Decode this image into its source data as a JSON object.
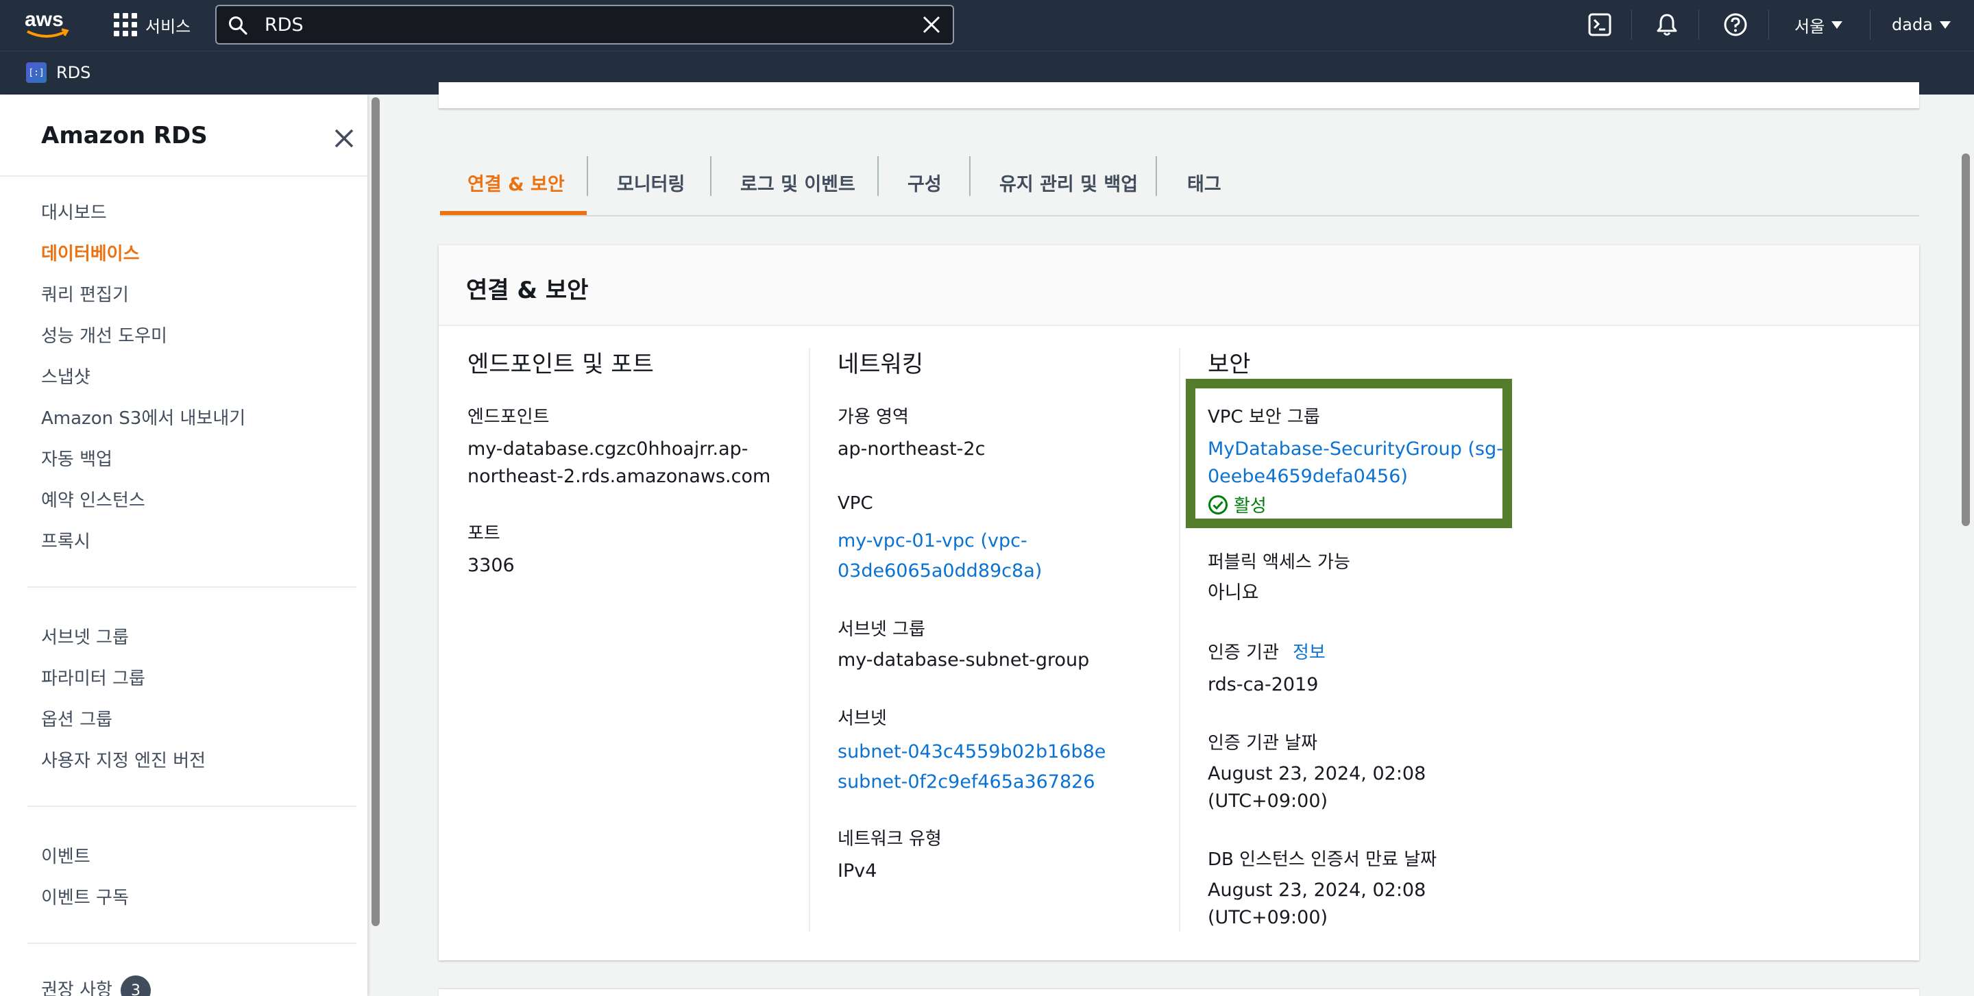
{
  "topnav": {
    "logo_text": "aws",
    "services_label": "서비스",
    "search_value": "RDS",
    "region_label": "서울",
    "user_label": "dada"
  },
  "breadcrumb": {
    "service": "RDS",
    "icon_glyph": "[:]"
  },
  "sidebar": {
    "title": "Amazon RDS",
    "group1": [
      "대시보드",
      "데이터베이스",
      "쿼리 편집기",
      "성능 개선 도우미",
      "스냅샷",
      "Amazon S3에서 내보내기",
      "자동 백업",
      "예약 인스턴스",
      "프록시"
    ],
    "group2": [
      "서브넷 그룹",
      "파라미터 그룹",
      "옵션 그룹",
      "사용자 지정 엔진 버전"
    ],
    "group3": [
      "이벤트",
      "이벤트 구독"
    ],
    "recommendations": {
      "label": "권장 사항",
      "count": "3"
    }
  },
  "tabs": [
    "연결 & 보안",
    "모니터링",
    "로그 및 이벤트",
    "구성",
    "유지 관리 및 백업",
    "태그"
  ],
  "section": {
    "title": "연결 & 보안",
    "endpoint_col": {
      "title": "엔드포인트 및 포트",
      "endpoint_label": "엔드포인트",
      "endpoint_line1": "my-database.cgzc0hhoajrr.ap-",
      "endpoint_line2": "northeast-2.rds.amazonaws.com",
      "port_label": "포트",
      "port_value": "3306"
    },
    "network_col": {
      "title": "네트워킹",
      "az_label": "가용 영역",
      "az_value": "ap-northeast-2c",
      "vpc_label": "VPC",
      "vpc_line1": "my-vpc-01-vpc (vpc-",
      "vpc_line2": "03de6065a0dd89c8a)",
      "subnet_group_label": "서브넷 그룹",
      "subnet_group_value": "my-database-subnet-group",
      "subnets_label": "서브넷",
      "subnet_1": "subnet-043c4559b02b16b8e",
      "subnet_2": "subnet-0f2c9ef465a367826",
      "network_type_label": "네트워크 유형",
      "network_type_value": "IPv4"
    },
    "security_col": {
      "title": "보안",
      "sg_label": "VPC 보안 그룹",
      "sg_line1": "MyDatabase-SecurityGroup (sg-",
      "sg_line2": "0eebe4659defa0456)",
      "sg_status": "활성",
      "public_label": "퍼블릭 액세스 가능",
      "public_value": "아니요",
      "ca_label": "인증 기관",
      "ca_info": "정보",
      "ca_value": "rds-ca-2019",
      "ca_date_label": "인증 기관 날짜",
      "ca_date_line1": "August 23, 2024, 02:08",
      "ca_date_line2": "(UTC+09:00)",
      "cert_exp_label": "DB 인스턴스 인증서 만료 날짜",
      "cert_exp_line1": "August 23, 2024, 02:08",
      "cert_exp_line2": "(UTC+09:00)"
    }
  },
  "colors": {
    "nav_bg": "#232f3e",
    "accent_orange": "#ec7211",
    "link_blue": "#0972d3",
    "success_green": "#037f0c",
    "highlight_green": "#537d2a"
  }
}
